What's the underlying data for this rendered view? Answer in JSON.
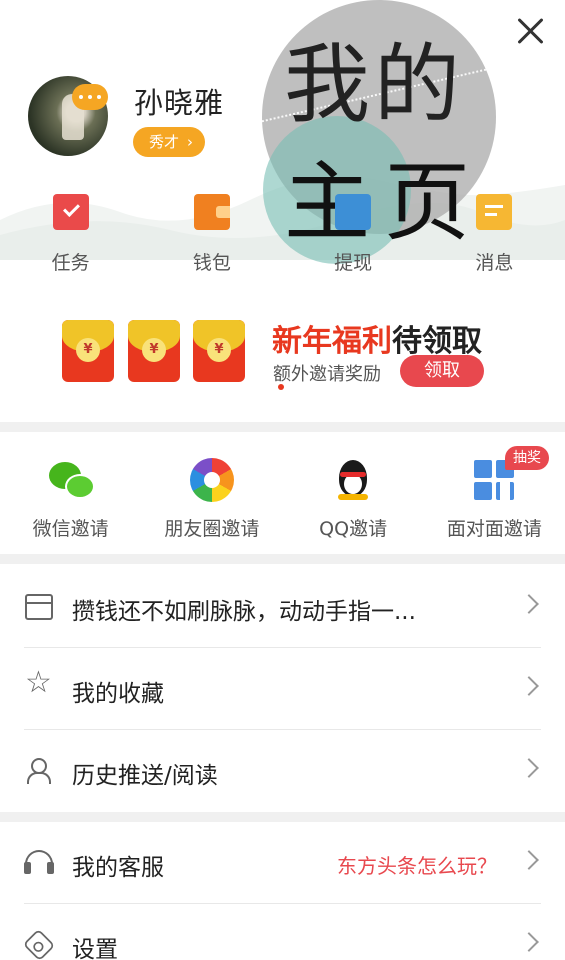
{
  "profile": {
    "username": "孙晓雅",
    "rank_label": "秀才",
    "rank_chevron": "›"
  },
  "watermark": {
    "line1": "我的",
    "line2": "主页"
  },
  "quick_actions": [
    {
      "label": "任务",
      "icon": "task-icon",
      "color": "#ea4a4a"
    },
    {
      "label": "钱包",
      "icon": "wallet-icon",
      "color": "#f08020"
    },
    {
      "label": "提现",
      "icon": "withdraw-icon",
      "color": "#3d8fd6"
    },
    {
      "label": "消息",
      "icon": "message-icon",
      "color": "#f6b733"
    }
  ],
  "banner": {
    "packet_symbol": "¥",
    "title_red": "新年福利",
    "title_dark": "待领取",
    "subtitle": "额外邀请奖励",
    "claim_button": "领取"
  },
  "invite": {
    "items": [
      {
        "label": "微信邀请",
        "icon": "wechat-icon"
      },
      {
        "label": "朋友圈邀请",
        "icon": "moments-icon"
      },
      {
        "label": "QQ邀请",
        "icon": "qq-icon"
      },
      {
        "label": "面对面邀请",
        "icon": "face-to-face-icon"
      }
    ],
    "badge": "抽奖"
  },
  "list": {
    "promo": "攒钱还不如刷脉脉，动动手指一...",
    "favorites": "我的收藏",
    "history": "历史推送/阅读",
    "customer_service": "我的客服",
    "customer_service_extra": "东方头条怎么玩？",
    "settings": "设置"
  },
  "colors": {
    "accent": "#f5a623",
    "red": "#e8484e",
    "background_divider": "#f0f0f0"
  }
}
